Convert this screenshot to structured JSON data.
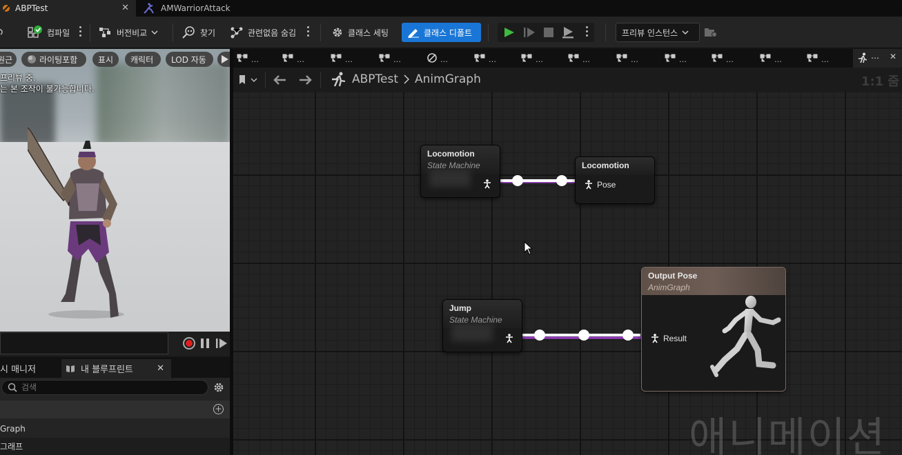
{
  "tabs": [
    {
      "label": "ABPTest",
      "active": true
    },
    {
      "label": "AMWarriorAttack",
      "active": false
    }
  ],
  "toolbar": {
    "compile": "컴파일",
    "version_compare": "버전비교",
    "find": "찾기",
    "hide_unrelated": "관련없음 숨김",
    "class_settings": "클래스 세팅",
    "class_defaults": "클래스 디폴트",
    "preview_instance": "프리뷰 인스턴스"
  },
  "viewport": {
    "pills": [
      "원근",
      "라이팅포함",
      "표시",
      "캐릭터",
      "LOD 자동"
    ],
    "notice_line1": "프리뷰 중.",
    "notice_line2": "는 본 조작이 불가능합니다."
  },
  "bottom_tabs": {
    "tab1": "시 매니저",
    "tab2": "내 블루프린트"
  },
  "my_blueprint": {
    "search_placeholder": "검색",
    "rows": [
      "Graph",
      "그래프"
    ]
  },
  "graph": {
    "breadcrumb_root": "ABPTest",
    "breadcrumb_leaf": "AnimGraph",
    "zoom": "1:1 줌",
    "nodes": {
      "loco_sm_title": "Locomotion",
      "loco_sm_sub": "State Machine",
      "loco_cache_title": "Locomotion",
      "loco_cache_pin": "Pose",
      "jump_title": "Jump",
      "jump_sub": "State Machine",
      "output_title": "Output Pose",
      "output_sub": "AnimGraph",
      "output_pin": "Result"
    }
  },
  "watermark": "애니메이션",
  "colors": {
    "accent": "#1a76d6",
    "play": "#3fba3f",
    "record": "#e01e1e",
    "wire_exec": "#ffffff",
    "wire_pose": "#9b3fc8"
  }
}
